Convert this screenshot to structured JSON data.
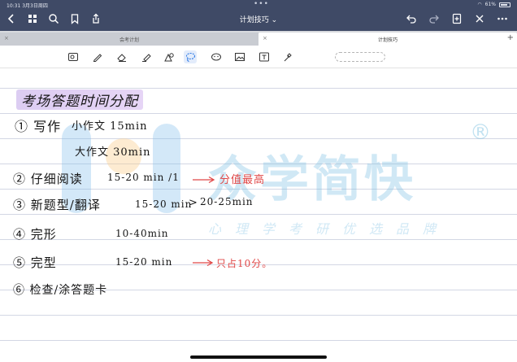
{
  "status": {
    "time": "10:31  3月3日周四",
    "battery": "61%"
  },
  "header": {
    "title": "计划技巧",
    "title_chevron": "⌄",
    "dots": "•••"
  },
  "tabs": [
    {
      "label": "会考计划"
    },
    {
      "label": "计划技巧"
    }
  ],
  "icons": {
    "back": "chevron-left-icon",
    "grid": "grid-icon",
    "search": "search-icon",
    "bookmark": "bookmark-icon",
    "share": "share-icon",
    "undo": "undo-icon",
    "redo": "redo-icon",
    "add_page": "add-page-icon",
    "close": "close-icon",
    "more": "more-icon"
  },
  "colors": {
    "nav_bg": "#3f4a66",
    "highlight": "#d6c4f0",
    "red_ink": "#e04848",
    "watermark": "#78bee1"
  },
  "notes": {
    "title": "考场答题时间分配",
    "line1_num": "① 写作",
    "line1_a": "小作文 15min",
    "line1_b": "大作文 30min",
    "line2": "② 仔细阅读",
    "line2_time": "15-20 min /1",
    "line2_note": "分值最高",
    "line3": "③ 新题型/翻译",
    "line3_time": "15-20 min",
    "line3_total": "20-25min",
    "line4": "④ 完形",
    "line4_time": "10-40min",
    "line5": "⑤ 完型",
    "line5_time": "15-20 min",
    "line5_note": "只占10分。",
    "line6": "⑥ 检查/涂答题卡"
  },
  "watermark": {
    "main": "众学简快",
    "sub": "心理学考研优选品牌",
    "reg": "®"
  }
}
